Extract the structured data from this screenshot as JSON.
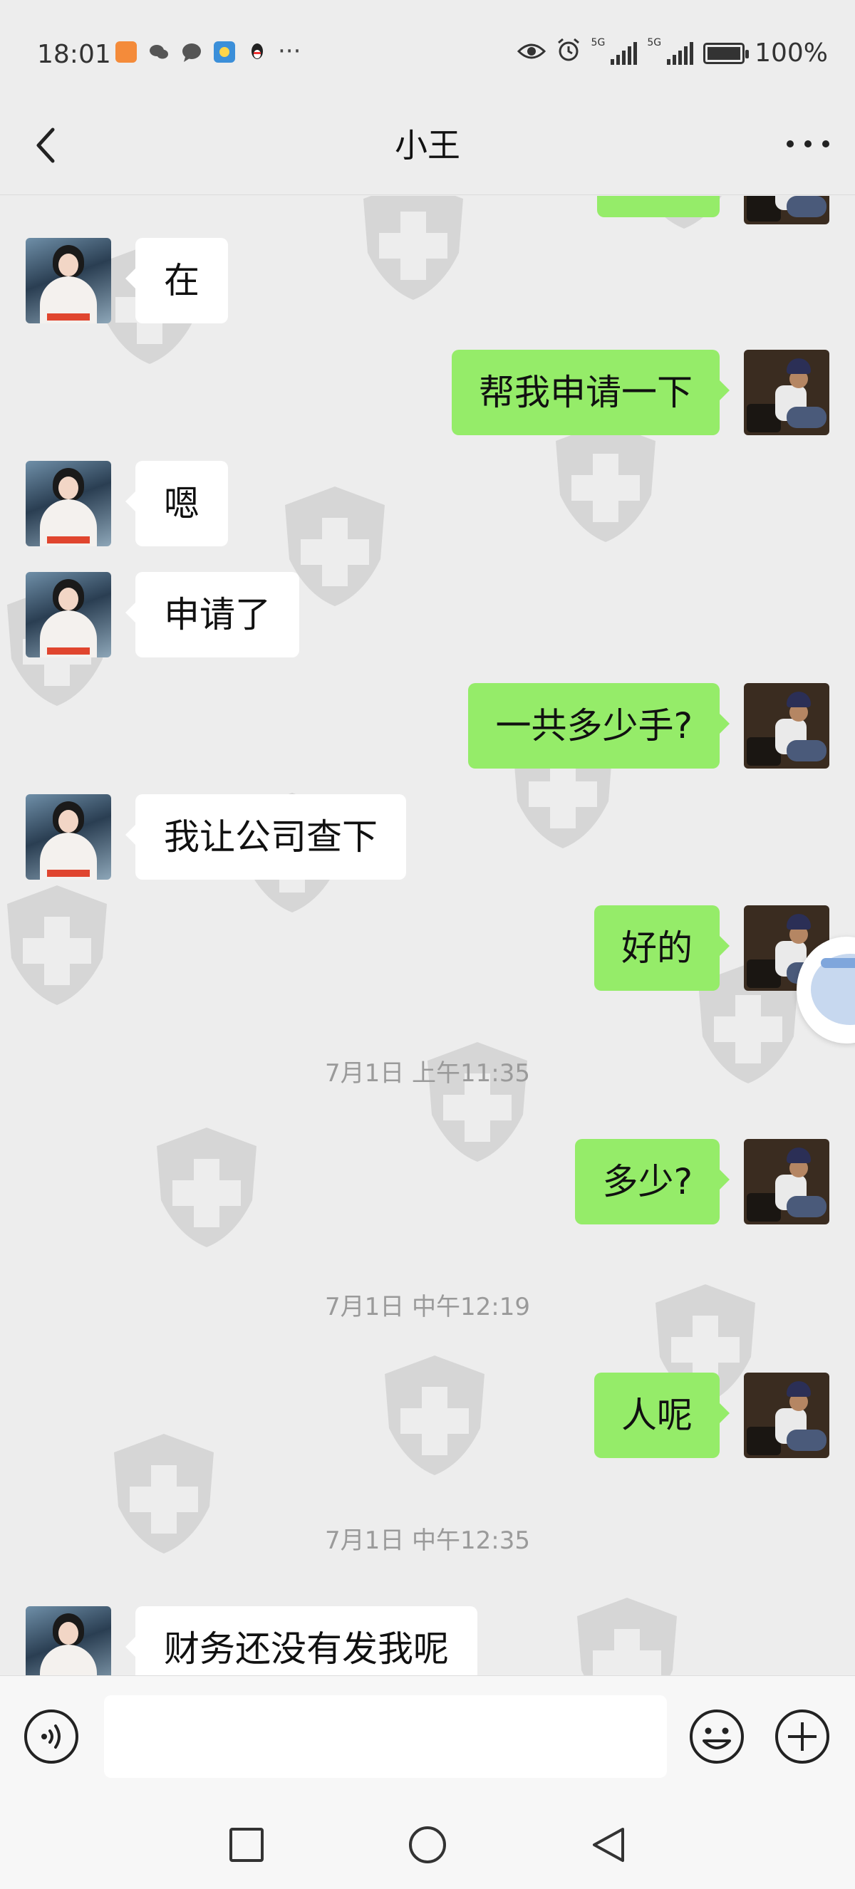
{
  "status_bar": {
    "time": "18:01",
    "network_1": "5G",
    "network_2": "5G",
    "battery": "100%",
    "notification_icons": [
      "taobao-icon",
      "wechat-icon",
      "message-icon",
      "weather-icon",
      "qq-icon"
    ],
    "more": "···"
  },
  "header": {
    "title": "小王"
  },
  "messages": [
    {
      "side": "left",
      "text": "在"
    },
    {
      "side": "right",
      "text": "帮我申请一下"
    },
    {
      "side": "left",
      "text": "嗯"
    },
    {
      "side": "left",
      "text": "申请了"
    },
    {
      "side": "right",
      "text": "一共多少手?"
    },
    {
      "side": "left",
      "text": "我让公司查下"
    },
    {
      "side": "right",
      "text": "好的"
    },
    {
      "side": "time",
      "text": "7月1日 上午11:35"
    },
    {
      "side": "right",
      "text": "多少?"
    },
    {
      "side": "time",
      "text": "7月1日 中午12:19"
    },
    {
      "side": "right",
      "text": "人呢"
    },
    {
      "side": "time",
      "text": "7月1日 中午12:35"
    },
    {
      "side": "left",
      "text": "财务还没有发我呢"
    }
  ],
  "input": {
    "value": "",
    "placeholder": ""
  },
  "colors": {
    "sent_bubble": "#95ec69",
    "received_bubble": "#ffffff",
    "background": "#ededed",
    "timestamp": "#9a9a9a"
  }
}
